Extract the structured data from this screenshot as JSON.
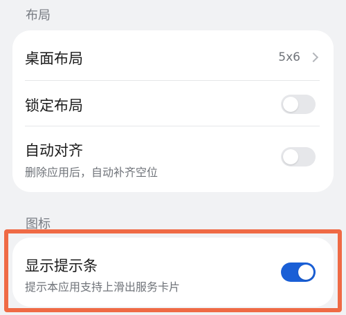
{
  "sections": {
    "layout_header": "布局",
    "icon_header": "图标"
  },
  "layout_card": {
    "desktop_layout": {
      "title": "桌面布局",
      "value": "5x6"
    },
    "lock_layout": {
      "title": "锁定布局",
      "toggle": "off"
    },
    "auto_align": {
      "title": "自动对齐",
      "subtitle": "删除应用后，自动补齐空位",
      "toggle": "off"
    }
  },
  "icon_card": {
    "show_indicator": {
      "title": "显示提示条",
      "subtitle": "提示本应用支持上滑出服务卡片",
      "toggle": "on"
    }
  },
  "colors": {
    "toggle_on": "#1a5fd6",
    "highlight_border": "#ef6a45"
  }
}
